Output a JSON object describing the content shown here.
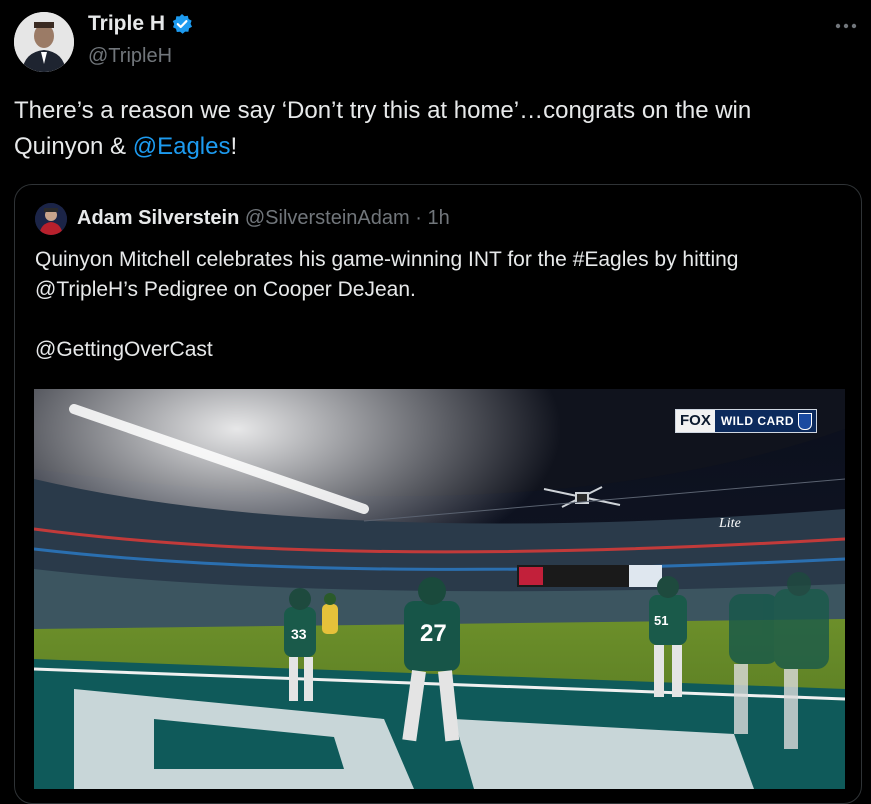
{
  "tweet": {
    "author_name": "Triple H",
    "author_handle": "@TripleH",
    "text_before_mention": "There’s a reason we say ‘Don’t try this at home’…congrats on the win Quinyon & ",
    "mention": "@Eagles",
    "text_after_mention": "!",
    "more_icon": "more-horizontal-icon",
    "verified_icon": "verified-badge-icon"
  },
  "quote": {
    "author_name": "Adam Silverstein",
    "author_handle": "@SilversteinAdam",
    "separator": "·",
    "time": "1h",
    "line1": "Quinyon Mitchell celebrates his game-winning INT for the #Eagles by hitting @TripleH’s Pedigree on Cooper DeJean.",
    "line2": "@GettingOverCast",
    "media": {
      "broadcast_logo": "FOX",
      "broadcast_label": "WILD CARD",
      "jersey_numbers": [
        "33",
        "27",
        "51"
      ],
      "stadium_sign": "Lite"
    }
  },
  "colors": {
    "background": "#000000",
    "text": "#e7e9ea",
    "secondary": "#71767b",
    "link": "#1d9bf0",
    "border": "#2f3336",
    "eagles_green": "#0f4a4a"
  }
}
